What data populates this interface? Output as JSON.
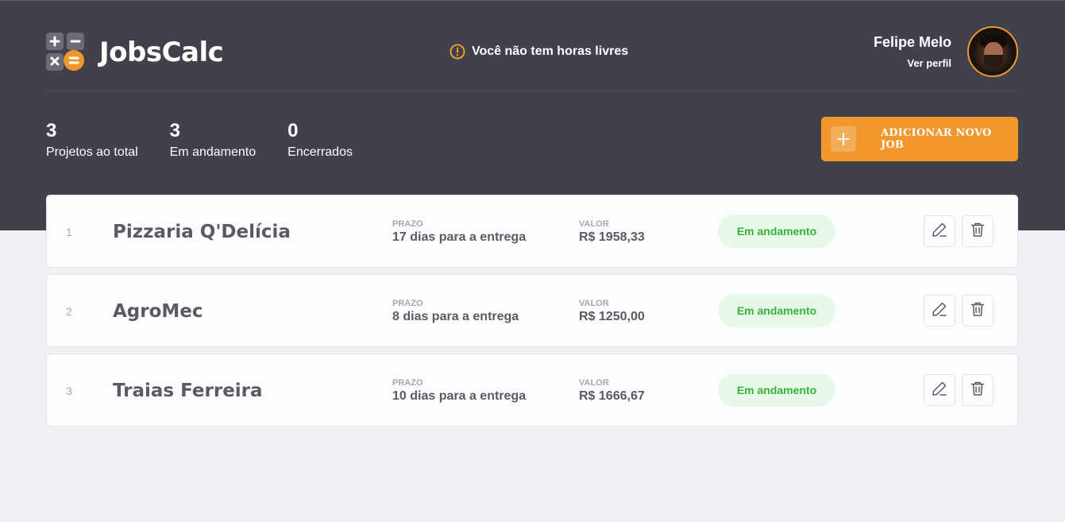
{
  "app": {
    "logo_text": "JobsCalc"
  },
  "header": {
    "notice": "Você não tem horas livres",
    "profile_name": "Felipe Melo",
    "profile_link": "Ver perfil"
  },
  "stats": [
    {
      "value": "3",
      "label": "Projetos ao total"
    },
    {
      "value": "3",
      "label": "Em andamento"
    },
    {
      "value": "0",
      "label": "Encerrados"
    }
  ],
  "add_button": {
    "label": "ADICIONAR NOVO JOB"
  },
  "field_labels": {
    "deadline": "PRAZO",
    "value": "VALOR"
  },
  "jobs": [
    {
      "id": "1",
      "name": "Pizzaria Q'Delícia",
      "deadline": "17 dias para a entrega",
      "value": "R$ 1958,33",
      "status": "Em andamento"
    },
    {
      "id": "2",
      "name": "AgroMec",
      "deadline": "8 dias para a entrega",
      "value": "R$ 1250,00",
      "status": "Em andamento"
    },
    {
      "id": "3",
      "name": "Traias Ferreira",
      "deadline": "10 dias para a entrega",
      "value": "R$ 1666,67",
      "status": "Em andamento"
    }
  ],
  "colors": {
    "header_bg": "#41414C",
    "page_bg": "#F0F1F4",
    "accent": "#F1972C",
    "status_bg": "#E6F8EA",
    "status_text": "#36B336"
  },
  "icons": {
    "logo": "calculator-icon",
    "notice": "alert-circle-icon",
    "add": "plus-icon",
    "edit": "pencil-icon",
    "delete": "trash-icon"
  }
}
